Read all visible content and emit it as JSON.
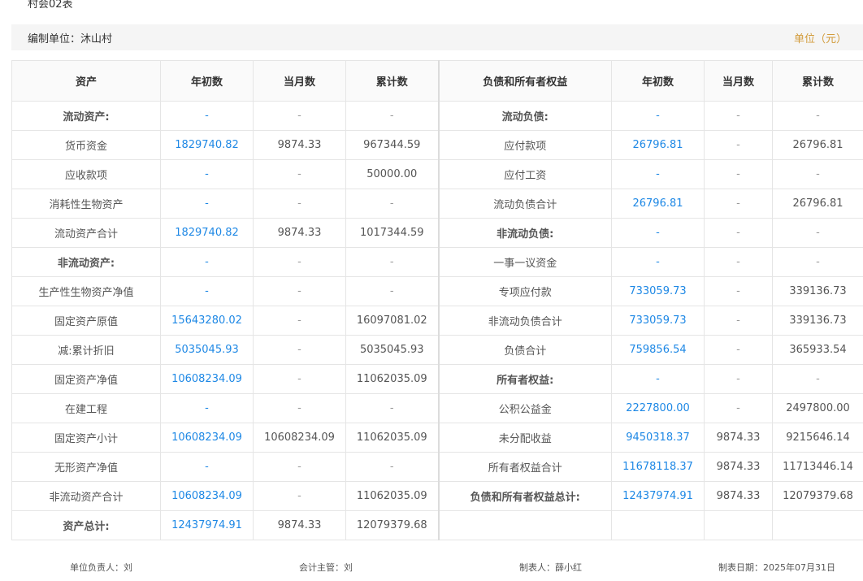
{
  "report": {
    "code": "村会02表",
    "unit_label": "编制单位：沐山村",
    "currency_label": "单位（元）"
  },
  "headers": [
    "资产",
    "年初数",
    "当月数",
    "累计数",
    "负债和所有者权益",
    "年初数",
    "当月数",
    "累计数"
  ],
  "rows": [
    {
      "a": "流动资产:",
      "a_b": true,
      "a1": "-",
      "a2": "-",
      "a3": "-",
      "l": "流动负债:",
      "l_b": true,
      "l1": "-",
      "l2": "-",
      "l3": "-"
    },
    {
      "a": "货币资金",
      "a1": "1829740.82",
      "a2": "9874.33",
      "a3": "967344.59",
      "l": "应付款项",
      "l1": "26796.81",
      "l2": "-",
      "l3": "26796.81"
    },
    {
      "a": "应收款项",
      "a1": "-",
      "a2": "-",
      "a3": "50000.00",
      "l": "应付工资",
      "l1": "-",
      "l2": "-",
      "l3": "-"
    },
    {
      "a": "消耗性生物资产",
      "a1": "-",
      "a2": "-",
      "a3": "-",
      "l": "流动负债合计",
      "l1": "26796.81",
      "l2": "-",
      "l3": "26796.81"
    },
    {
      "a": "流动资产合计",
      "a1": "1829740.82",
      "a2": "9874.33",
      "a3": "1017344.59",
      "l": "非流动负债:",
      "l_b": true,
      "l1": "-",
      "l2": "-",
      "l3": "-"
    },
    {
      "a": "非流动资产:",
      "a_b": true,
      "a1": "-",
      "a2": "-",
      "a3": "-",
      "l": "一事一议资金",
      "l1": "-",
      "l2": "-",
      "l3": "-"
    },
    {
      "a": "生产性生物资产净值",
      "a1": "-",
      "a2": "-",
      "a3": "-",
      "l": "专项应付款",
      "l1": "733059.73",
      "l2": "-",
      "l3": "339136.73"
    },
    {
      "a": "固定资产原值",
      "a1": "15643280.02",
      "a2": "-",
      "a3": "16097081.02",
      "l": "非流动负债合计",
      "l1": "733059.73",
      "l2": "-",
      "l3": "339136.73"
    },
    {
      "a": "减:累计折旧",
      "a1": "5035045.93",
      "a2": "-",
      "a3": "5035045.93",
      "l": "负债合计",
      "l1": "759856.54",
      "l2": "-",
      "l3": "365933.54"
    },
    {
      "a": "固定资产净值",
      "a1": "10608234.09",
      "a2": "-",
      "a3": "11062035.09",
      "l": "所有者权益:",
      "l_b": true,
      "l1": "-",
      "l2": "-",
      "l3": "-"
    },
    {
      "a": "在建工程",
      "a1": "-",
      "a2": "-",
      "a3": "-",
      "l": "公积公益金",
      "l1": "2227800.00",
      "l2": "-",
      "l3": "2497800.00"
    },
    {
      "a": "固定资产小计",
      "a1": "10608234.09",
      "a2": "10608234.09",
      "a3": "11062035.09",
      "l": "未分配收益",
      "l1": "9450318.37",
      "l2": "9874.33",
      "l3": "9215646.14"
    },
    {
      "a": "无形资产净值",
      "a1": "-",
      "a2": "-",
      "a3": "-",
      "l": "所有者权益合计",
      "l1": "11678118.37",
      "l2": "9874.33",
      "l3": "11713446.14"
    },
    {
      "a": "非流动资产合计",
      "a1": "10608234.09",
      "a2": "-",
      "a3": "11062035.09",
      "l": "负债和所有者权益总计:",
      "l_b": true,
      "l1": "12437974.91",
      "l2": "9874.33",
      "l3": "12079379.68"
    },
    {
      "a": "资产总计:",
      "a_b": true,
      "a1": "12437974.91",
      "a2": "9874.33",
      "a3": "12079379.68",
      "l": "",
      "l1": "",
      "l2": "",
      "l3": ""
    }
  ],
  "footer": {
    "principal": "单位负责人：刘",
    "accountant": "会计主管：刘",
    "preparer": "制表人：薛小红",
    "date": "制表日期：2025年07月31日"
  },
  "colors": {
    "link": "#1e88e5",
    "unit": "#d29b3a",
    "border": "#e5e5e5"
  }
}
